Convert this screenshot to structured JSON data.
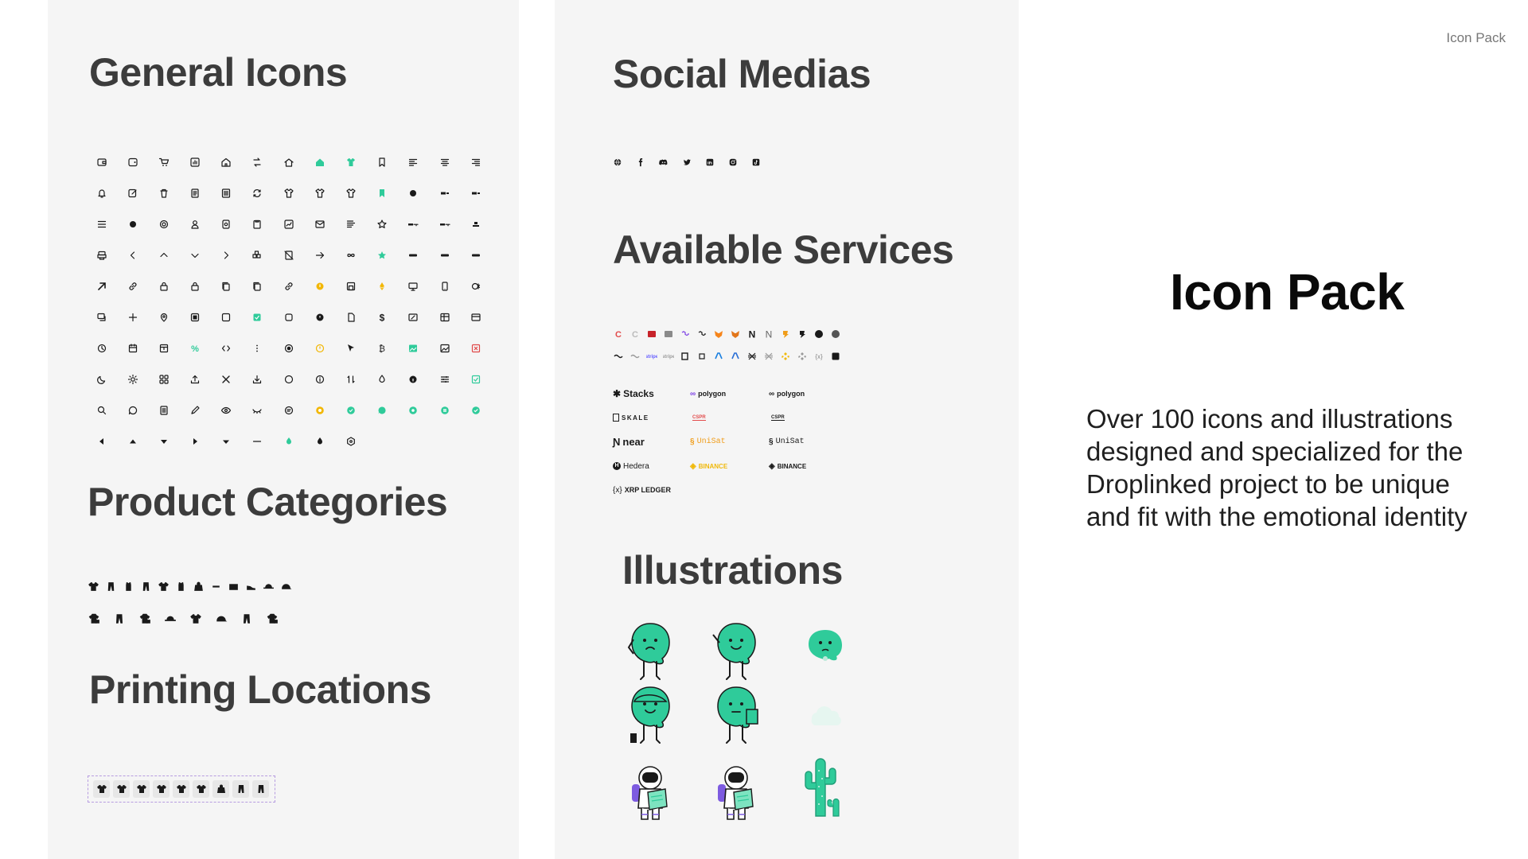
{
  "header": {
    "label": "Icon Pack"
  },
  "hero": {
    "title": "Icon Pack",
    "description": "Over 100 icons and illustrations designed and specialized for the Droplinked project to be unique and fit with the emotional identity"
  },
  "sections": {
    "general_icons": "General Icons",
    "product_categories": "Product Categories",
    "printing_locations": "Printing Locations",
    "social_medias": "Social Medias",
    "available_services": "Available Services",
    "illustrations": "Illustrations"
  },
  "colors": {
    "accent_green": "#2fcb9a",
    "icon_dark": "#1a1a1a",
    "panel_bg": "#f5f5f5",
    "warning_yellow": "#f2b705",
    "error_red": "#e04848"
  },
  "service_logos": [
    {
      "name": "Stacks",
      "label": "Stacks",
      "icon": "stacks-icon",
      "color": "#1a1a1a"
    },
    {
      "name": "polygon-color",
      "label": "polygon",
      "icon": "polygon-icon",
      "color": "#7b3fe4"
    },
    {
      "name": "polygon-mono",
      "label": "polygon",
      "icon": "polygon-icon",
      "color": "#1a1a1a"
    },
    {
      "name": "Skale",
      "label": "SKALE",
      "icon": "skale-icon",
      "color": "#1a1a1a"
    },
    {
      "name": "casper-color",
      "label": "CSPR",
      "icon": "casper-icon",
      "color": "#e24b4b"
    },
    {
      "name": "casper-mono",
      "label": "CSPR",
      "icon": "casper-icon",
      "color": "#1a1a1a"
    },
    {
      "name": "near",
      "label": "near",
      "icon": "near-icon",
      "color": "#1a1a1a"
    },
    {
      "name": "unisat-color",
      "label": "UniSat",
      "icon": "unisat-icon",
      "color": "#f09d1a"
    },
    {
      "name": "unisat-mono",
      "label": "UniSat",
      "icon": "unisat-icon",
      "color": "#1a1a1a"
    },
    {
      "name": "Hedera",
      "label": "Hedera",
      "icon": "hedera-icon",
      "color": "#1a1a1a"
    },
    {
      "name": "binance-color",
      "label": "BINANCE",
      "icon": "binance-icon",
      "color": "#f0b90b"
    },
    {
      "name": "binance-mono",
      "label": "BINANCE",
      "icon": "binance-icon",
      "color": "#1a1a1a"
    },
    {
      "name": "xrp-ledger",
      "label": "XRP LEDGER",
      "icon": "xrp-icon",
      "color": "#1a1a1a"
    }
  ]
}
